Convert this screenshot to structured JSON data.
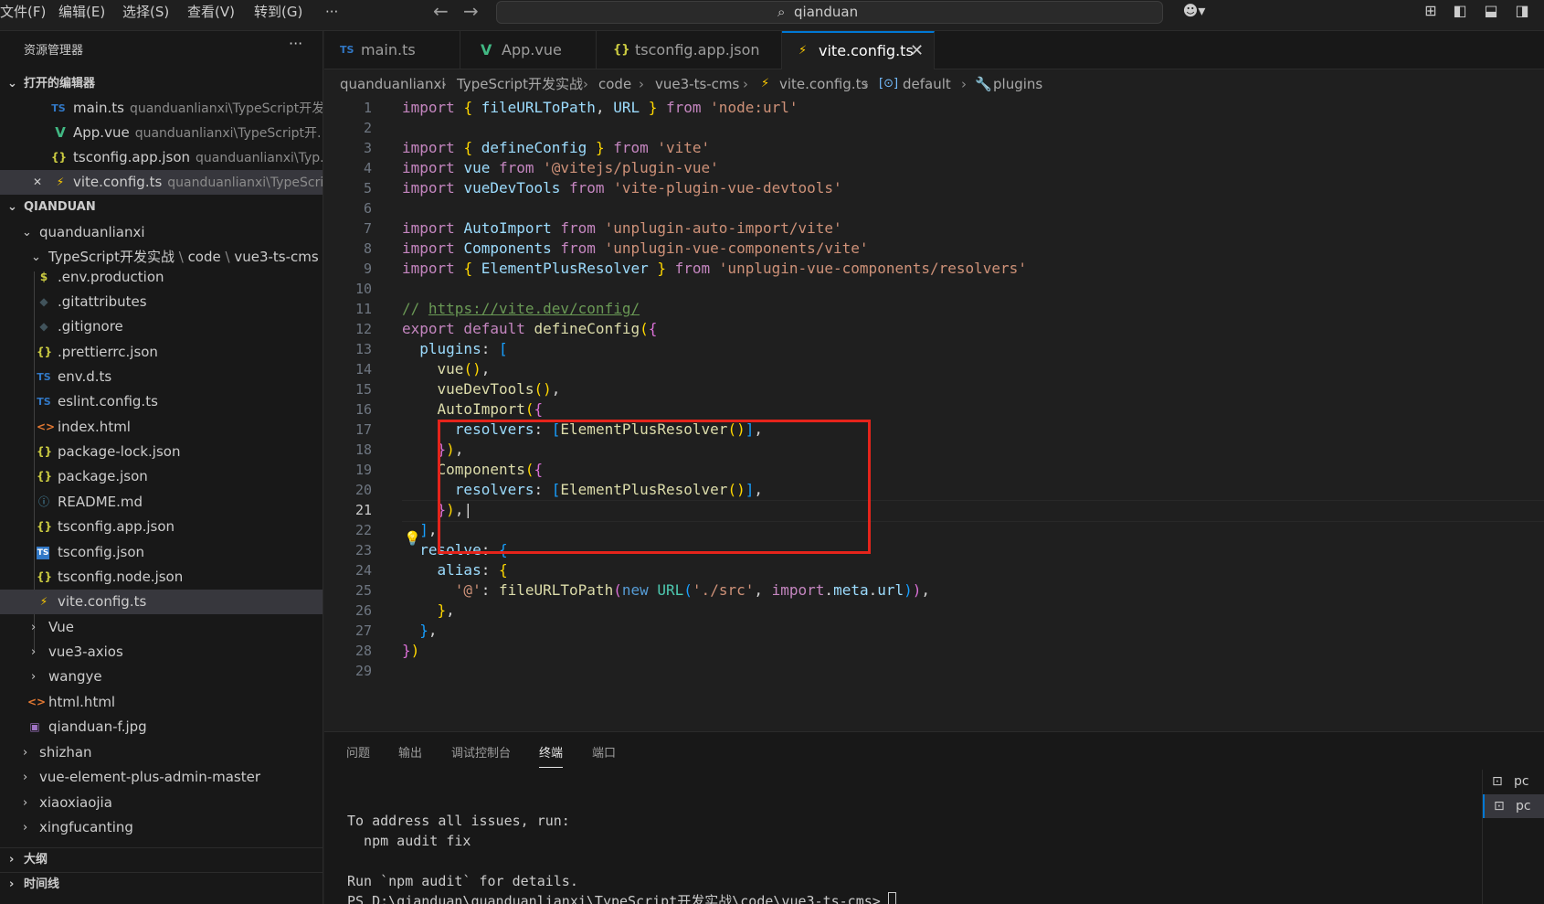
{
  "menu": [
    "文件(F)",
    "编辑(E)",
    "选择(S)",
    "查看(V)",
    "转到(G)",
    "···"
  ],
  "command_center": {
    "text": "qianduan",
    "icon": "search-icon"
  },
  "titlebar_icons": [
    "copilot-icon",
    "layout-customize-icon",
    "toggle-sidebar-icon",
    "toggle-panel-icon",
    "toggle-secondary-sidebar-icon"
  ],
  "explorer": {
    "title": "资源管理器",
    "more": "···",
    "open_editors": {
      "title": "打开的编辑器",
      "items": [
        {
          "icon": "TS",
          "name": "main.ts",
          "path": "quanduanlianxi\\TypeScript开发..."
        },
        {
          "icon": "V",
          "name": "App.vue",
          "path": "quanduanlianxi\\TypeScript开..."
        },
        {
          "icon": "{}",
          "name": "tsconfig.app.json",
          "path": "quanduanlianxi\\Typ..."
        },
        {
          "icon": "⚡",
          "name": "vite.config.ts",
          "path": "quanduanlianxi\\TypeScri...",
          "close": "✕"
        }
      ]
    },
    "workspace": {
      "title": "QIANDUAN",
      "root": "quanduanlianxi",
      "project_path": [
        "TypeScript开发实战",
        "code",
        "vue3-ts-cms"
      ],
      "files": [
        {
          "icon": "$",
          "name": ".env.production"
        },
        {
          "icon": "◆",
          "name": ".gitattributes"
        },
        {
          "icon": "◆",
          "name": ".gitignore"
        },
        {
          "icon": "{}",
          "name": ".prettierrc.json"
        },
        {
          "icon": "TS",
          "name": "env.d.ts"
        },
        {
          "icon": "TS",
          "name": "eslint.config.ts"
        },
        {
          "icon": "<>",
          "name": "index.html"
        },
        {
          "icon": "{}",
          "name": "package-lock.json"
        },
        {
          "icon": "{}",
          "name": "package.json"
        },
        {
          "icon": "ⓘ",
          "name": "README.md"
        },
        {
          "icon": "{}",
          "name": "tsconfig.app.json"
        },
        {
          "icon": "TS",
          "name": "tsconfig.json"
        },
        {
          "icon": "{}",
          "name": "tsconfig.node.json"
        },
        {
          "icon": "⚡",
          "name": "vite.config.ts"
        }
      ],
      "sub_folders": [
        "Vue",
        "vue3-axios",
        "wangye"
      ],
      "sub_files": [
        {
          "icon": "<>",
          "name": "html.html"
        },
        {
          "icon": "▣",
          "name": "qianduan-f.jpg"
        }
      ],
      "top_folders": [
        "shizhan",
        "vue-element-plus-admin-master",
        "xiaoxiaojia",
        "xingfucanting"
      ]
    },
    "outline": "大纲",
    "timeline": "时间线"
  },
  "tabs": [
    {
      "icon": "TS",
      "label": "main.ts"
    },
    {
      "icon": "V",
      "label": "App.vue"
    },
    {
      "icon": "{}",
      "label": "tsconfig.app.json"
    },
    {
      "icon": "⚡",
      "label": "vite.config.ts",
      "active": true,
      "close": "✕"
    }
  ],
  "breadcrumbs": [
    "quanduanlianxi",
    "TypeScript开发实战",
    "code",
    "vue3-ts-cms",
    "vite.config.ts",
    "default",
    "plugins"
  ],
  "editor": {
    "current_line": 21,
    "lines": [
      [
        [
          "ki",
          "import "
        ],
        [
          "b1",
          "{ "
        ],
        [
          "v",
          "fileURLToPath"
        ],
        [
          "p",
          ", "
        ],
        [
          "v",
          "URL "
        ],
        [
          "b1",
          "} "
        ],
        [
          "ki",
          "from "
        ],
        [
          "s",
          "'node:url'"
        ]
      ],
      [],
      [
        [
          "ki",
          "import "
        ],
        [
          "b1",
          "{ "
        ],
        [
          "v",
          "defineConfig "
        ],
        [
          "b1",
          "} "
        ],
        [
          "ki",
          "from "
        ],
        [
          "s",
          "'vite'"
        ]
      ],
      [
        [
          "ki",
          "import "
        ],
        [
          "v",
          "vue "
        ],
        [
          "ki",
          "from "
        ],
        [
          "s",
          "'@vitejs/plugin-vue'"
        ]
      ],
      [
        [
          "ki",
          "import "
        ],
        [
          "v",
          "vueDevTools "
        ],
        [
          "ki",
          "from "
        ],
        [
          "s",
          "'vite-plugin-vue-devtools'"
        ]
      ],
      [],
      [
        [
          "ki",
          "import "
        ],
        [
          "v",
          "AutoImport "
        ],
        [
          "ki",
          "from "
        ],
        [
          "s",
          "'unplugin-auto-import/vite'"
        ]
      ],
      [
        [
          "ki",
          "import "
        ],
        [
          "v",
          "Components "
        ],
        [
          "ki",
          "from "
        ],
        [
          "s",
          "'unplugin-vue-components/vite'"
        ]
      ],
      [
        [
          "ki",
          "import "
        ],
        [
          "b1",
          "{ "
        ],
        [
          "v",
          "ElementPlusResolver "
        ],
        [
          "b1",
          "} "
        ],
        [
          "ki",
          "from "
        ],
        [
          "s",
          "'unplugin-vue-components/resolvers'"
        ]
      ],
      [],
      [
        [
          "c",
          "// "
        ],
        [
          "link",
          "https://vite.dev/config/"
        ]
      ],
      [
        [
          "ki",
          "export default "
        ],
        [
          "f",
          "defineConfig"
        ],
        [
          "b1",
          "("
        ],
        [
          "b2",
          "{"
        ]
      ],
      [
        [
          "p",
          "  "
        ],
        [
          "v",
          "plugins"
        ],
        [
          "p",
          ": "
        ],
        [
          "b3",
          "["
        ]
      ],
      [
        [
          "p",
          "    "
        ],
        [
          "f",
          "vue"
        ],
        [
          "b1",
          "()"
        ],
        [
          "p",
          ","
        ]
      ],
      [
        [
          "p",
          "    "
        ],
        [
          "f",
          "vueDevTools"
        ],
        [
          "b1",
          "()"
        ],
        [
          "p",
          ","
        ]
      ],
      [
        [
          "p",
          "    "
        ],
        [
          "f",
          "AutoImport"
        ],
        [
          "b1",
          "("
        ],
        [
          "b2",
          "{"
        ]
      ],
      [
        [
          "p",
          "      "
        ],
        [
          "v",
          "resolvers"
        ],
        [
          "p",
          ": "
        ],
        [
          "b3",
          "["
        ],
        [
          "f",
          "ElementPlusResolver"
        ],
        [
          "b1",
          "()"
        ],
        [
          "b3",
          "]"
        ],
        [
          "p",
          ","
        ]
      ],
      [
        [
          "p",
          "    "
        ],
        [
          "b2",
          "}"
        ],
        [
          "b1",
          ")"
        ],
        [
          "p",
          ","
        ]
      ],
      [
        [
          "p",
          "    "
        ],
        [
          "f",
          "Components"
        ],
        [
          "b1",
          "("
        ],
        [
          "b2",
          "{"
        ]
      ],
      [
        [
          "p",
          "      "
        ],
        [
          "v",
          "resolvers"
        ],
        [
          "p",
          ": "
        ],
        [
          "b3",
          "["
        ],
        [
          "f",
          "ElementPlusResolver"
        ],
        [
          "b1",
          "()"
        ],
        [
          "b3",
          "]"
        ],
        [
          "p",
          ","
        ]
      ],
      [
        [
          "p",
          "    "
        ],
        [
          "b2",
          "}"
        ],
        [
          "b1",
          ")"
        ],
        [
          "p",
          ",|"
        ]
      ],
      [
        [
          "p",
          "  "
        ],
        [
          "b3",
          "]"
        ],
        [
          "p",
          ","
        ]
      ],
      [
        [
          "p",
          "  "
        ],
        [
          "v",
          "resolve"
        ],
        [
          "p",
          ": "
        ],
        [
          "b3",
          "{"
        ]
      ],
      [
        [
          "p",
          "    "
        ],
        [
          "v",
          "alias"
        ],
        [
          "p",
          ": "
        ],
        [
          "b1",
          "{"
        ]
      ],
      [
        [
          "p",
          "      "
        ],
        [
          "s",
          "'@'"
        ],
        [
          "p",
          ": "
        ],
        [
          "f",
          "fileURLToPath"
        ],
        [
          "b2",
          "("
        ],
        [
          "k",
          "new "
        ],
        [
          "cls",
          "URL"
        ],
        [
          "b3",
          "("
        ],
        [
          "s",
          "'./src'"
        ],
        [
          "p",
          ", "
        ],
        [
          "ki",
          "import"
        ],
        [
          "p",
          "."
        ],
        [
          "v",
          "meta"
        ],
        [
          "p",
          "."
        ],
        [
          "v",
          "url"
        ],
        [
          "b3",
          ")"
        ],
        [
          "b2",
          ")"
        ],
        [
          "p",
          ","
        ]
      ],
      [
        [
          "p",
          "    "
        ],
        [
          "b1",
          "}"
        ],
        [
          "p",
          ","
        ]
      ],
      [
        [
          "p",
          "  "
        ],
        [
          "b3",
          "}"
        ],
        [
          "p",
          ","
        ]
      ],
      [
        [
          "b2",
          "}"
        ],
        [
          "b1",
          ")"
        ]
      ],
      []
    ]
  },
  "panel": {
    "tabs": [
      "问题",
      "输出",
      "调试控制台",
      "终端",
      "端口"
    ],
    "active_tab": "终端",
    "terminal_lines": [
      "To address all issues, run:",
      "  npm audit fix",
      "",
      "Run `npm audit` for details.",
      "PS D:\\qianduan\\quanduanlianxi\\TypeScript开发实战\\code\\vue3-ts-cms>"
    ],
    "terminal_instances": [
      "pc",
      "pc"
    ]
  }
}
